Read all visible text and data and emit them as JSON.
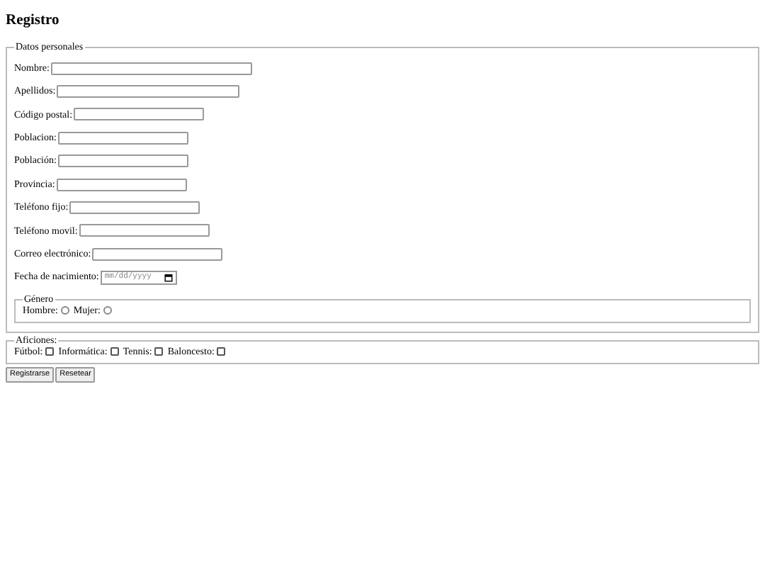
{
  "title": "Registro",
  "personal": {
    "legend": "Datos personales",
    "fields": [
      {
        "label": "Nombre:",
        "kind": "text"
      },
      {
        "label": "Apellidos:",
        "kind": "text"
      },
      {
        "label": "Código postal:",
        "kind": "text"
      },
      {
        "label": "Poblacion:",
        "kind": "text"
      },
      {
        "label": "Población:",
        "kind": "text"
      },
      {
        "label": "Provincia:",
        "kind": "text"
      },
      {
        "label": "Teléfono fijo:",
        "kind": "text"
      },
      {
        "label": "Teléfono movil:",
        "kind": "text"
      },
      {
        "label": "Correo electrónico:",
        "kind": "text"
      },
      {
        "label": "Fecha de nacimiento:",
        "kind": "date",
        "placeholder": "mm/dd/yyyy"
      }
    ],
    "gender": {
      "legend": "Género",
      "options": [
        {
          "label": "Hombre:",
          "selected": false
        },
        {
          "label": "Mujer:",
          "selected": false
        }
      ]
    }
  },
  "hobbies": {
    "legend": "Aficiones:",
    "options": [
      {
        "label": "Fútbol:",
        "checked": false
      },
      {
        "label": "Informática:",
        "checked": false
      },
      {
        "label": "Tennis:",
        "checked": false
      },
      {
        "label": "Baloncesto:",
        "checked": false
      }
    ]
  },
  "buttons": [
    "Registrarse",
    "Resetear"
  ]
}
